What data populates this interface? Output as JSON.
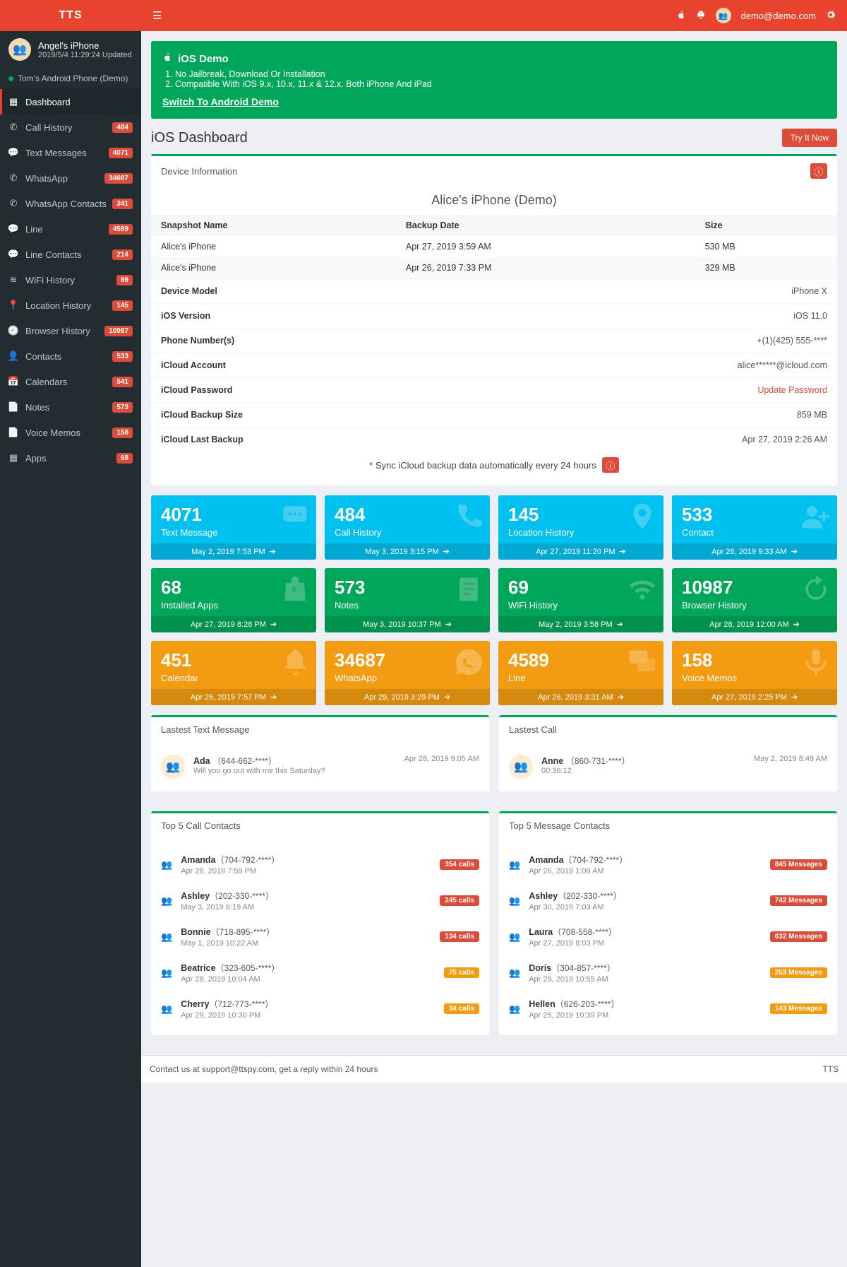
{
  "brand": "TTS",
  "topbar": {
    "email": "demo@demo.com"
  },
  "profile": {
    "name": "Angel's iPhone",
    "updated": "2019/5/4 11:29:24 Updated"
  },
  "alt_device": "Tom's Android Phone (Demo)",
  "nav": [
    {
      "label": "Dashboard",
      "badge": "",
      "icon": "grid"
    },
    {
      "label": "Call History",
      "badge": "484",
      "icon": "phone"
    },
    {
      "label": "Text Messages",
      "badge": "4071",
      "icon": "comment"
    },
    {
      "label": "WhatsApp",
      "badge": "34687",
      "icon": "wa"
    },
    {
      "label": "WhatsApp Contacts",
      "badge": "341",
      "icon": "wa"
    },
    {
      "label": "Line",
      "badge": "4589",
      "icon": "chat"
    },
    {
      "label": "Line Contacts",
      "badge": "214",
      "icon": "chat"
    },
    {
      "label": "WiFi History",
      "badge": "69",
      "icon": "wifi"
    },
    {
      "label": "Location History",
      "badge": "145",
      "icon": "pin"
    },
    {
      "label": "Browser History",
      "badge": "10987",
      "icon": "clock"
    },
    {
      "label": "Contacts",
      "badge": "533",
      "icon": "user"
    },
    {
      "label": "Calendars",
      "badge": "541",
      "icon": "cal"
    },
    {
      "label": "Notes",
      "badge": "573",
      "icon": "note"
    },
    {
      "label": "Voice Memos",
      "badge": "158",
      "icon": "file"
    },
    {
      "label": "Apps",
      "badge": "68",
      "icon": "apps"
    }
  ],
  "callout": {
    "title": "iOS Demo",
    "li1": "No Jailbreak, Download Or Installation",
    "li2": "Compatible With iOS 9.x, 10.x, 11.x & 12.x. Both iPhone And iPad",
    "link": "Switch To Android Demo"
  },
  "page": {
    "title": "iOS Dashboard",
    "cta": "Try It Now"
  },
  "devinfo": {
    "header": "Device Information",
    "demo_title": "Alice's iPhone (Demo)",
    "cols": {
      "c1": "Snapshot Name",
      "c2": "Backup Date",
      "c3": "Size"
    },
    "snapshots": [
      {
        "name": "Alice's iPhone",
        "date": "Apr 27, 2019 3:59 AM",
        "size": "530 MB"
      },
      {
        "name": "Alice's iPhone",
        "date": "Apr 26, 2019 7:33 PM",
        "size": "329 MB"
      }
    ],
    "kv": [
      {
        "k": "Device Model",
        "v": "iPhone X"
      },
      {
        "k": "iOS Version",
        "v": "iOS 11.0"
      },
      {
        "k": "Phone Number(s)",
        "v": "+(1)(425) 555-****"
      },
      {
        "k": "iCloud Account",
        "v": "alice******@icloud.com"
      },
      {
        "k": "iCloud Password",
        "v": "Update Password",
        "link": true
      },
      {
        "k": "iCloud Backup Size",
        "v": "859 MB"
      },
      {
        "k": "iCloud Last Backup",
        "v": "Apr 27, 2019 2:26 AM"
      }
    ],
    "sync_note": "* Sync iCloud backup data automatically every 24 hours"
  },
  "tiles": [
    {
      "num": "4071",
      "label": "Text Message",
      "ts": "May 2, 2019 7:53 PM",
      "color": "cyan",
      "icon": "sms"
    },
    {
      "num": "484",
      "label": "Call History",
      "ts": "May 3, 2019 3:15 PM",
      "color": "cyan",
      "icon": "phone"
    },
    {
      "num": "145",
      "label": "Location History",
      "ts": "Apr 27, 2019 11:20 PM",
      "color": "cyan",
      "icon": "pin"
    },
    {
      "num": "533",
      "label": "Contact",
      "ts": "Apr 26, 2019 9:33 AM",
      "color": "cyan",
      "icon": "adduser"
    },
    {
      "num": "68",
      "label": "Installed Apps",
      "ts": "Apr 27, 2019 8:28 PM",
      "color": "green",
      "icon": "bag"
    },
    {
      "num": "573",
      "label": "Notes",
      "ts": "May 3, 2019 10:37 PM",
      "color": "green",
      "icon": "doc"
    },
    {
      "num": "69",
      "label": "WiFi History",
      "ts": "May 2, 2019 3:58 PM",
      "color": "green",
      "icon": "wifi"
    },
    {
      "num": "10987",
      "label": "Browser History",
      "ts": "Apr 28, 2019 12:00 AM",
      "color": "green",
      "icon": "refresh"
    },
    {
      "num": "451",
      "label": "Calendar",
      "ts": "Apr 26, 2019 7:57 PM",
      "color": "orange",
      "icon": "bell"
    },
    {
      "num": "34687",
      "label": "WhatsApp",
      "ts": "Apr 29, 2019 3:29 PM",
      "color": "orange",
      "icon": "wa2"
    },
    {
      "num": "4589",
      "label": "Line",
      "ts": "Apr 26, 2019 3:31 AM",
      "color": "orange",
      "icon": "chats"
    },
    {
      "num": "158",
      "label": "Voice Memos",
      "ts": "Apr 27, 2019 2:25 PM",
      "color": "orange",
      "icon": "mic"
    }
  ],
  "latest_text": {
    "header": "Lastest Text Message",
    "name": "Ada",
    "phone": "（644-662-****）",
    "body": "Will you go out with me this Saturday?",
    "ts": "Apr 28, 2019 9:05 AM"
  },
  "latest_call": {
    "header": "Lastest Call",
    "name": "Anne",
    "phone": "（860-731-****）",
    "dur": "00:36:12",
    "ts": "May 2, 2019 8:49 AM"
  },
  "top5calls": {
    "header": "Top 5 Call Contacts",
    "rows": [
      {
        "name": "Amanda",
        "phone": "（704-792-****）",
        "sub": "Apr 28, 2019 7:59 PM",
        "pill": "354 calls",
        "pc": "red"
      },
      {
        "name": "Ashley",
        "phone": "（202-330-****）",
        "sub": "May 3, 2019 6:19 AM",
        "pill": "245 calls",
        "pc": "red"
      },
      {
        "name": "Bonnie",
        "phone": "（718-895-****）",
        "sub": "May 1, 2019 10:22 AM",
        "pill": "134 calls",
        "pc": "red"
      },
      {
        "name": "Beatrice",
        "phone": "（323-605-****）",
        "sub": "Apr 28, 2019 10:04 AM",
        "pill": "75 calls",
        "pc": "orange"
      },
      {
        "name": "Cherry",
        "phone": "（712-773-****）",
        "sub": "Apr 29, 2019 10:30 PM",
        "pill": "34 calls",
        "pc": "orange"
      }
    ]
  },
  "top5msgs": {
    "header": "Top 5 Message Contacts",
    "rows": [
      {
        "name": "Amanda",
        "phone": "（704-792-****）",
        "sub": "Apr 26, 2019 1:09 AM",
        "pill": "845 Messages",
        "pc": "red"
      },
      {
        "name": "Ashley",
        "phone": "（202-330-****）",
        "sub": "Apr 30, 2019 7:03 AM",
        "pill": "742 Messages",
        "pc": "red"
      },
      {
        "name": "Laura",
        "phone": "（708-558-****）",
        "sub": "Apr 27, 2019 8:03 PM",
        "pill": "632 Messages",
        "pc": "red"
      },
      {
        "name": "Doris",
        "phone": "（304-857-****）",
        "sub": "Apr 29, 2019 10:55 AM",
        "pill": "253 Messages",
        "pc": "orange"
      },
      {
        "name": "Hellen",
        "phone": "（626-203-****）",
        "sub": "Apr 25, 2019 10:39 PM",
        "pill": "143 Messages",
        "pc": "orange"
      }
    ]
  },
  "footer": {
    "left": "Contact us at support@ttspy.com, get a reply within 24 hours",
    "right": "TTS"
  }
}
